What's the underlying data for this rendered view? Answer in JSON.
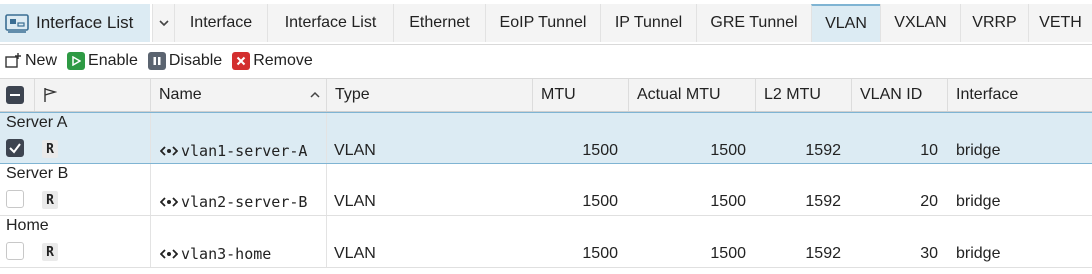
{
  "window": {
    "title": "Interface List"
  },
  "tabs": [
    {
      "label": "Interface",
      "active": false
    },
    {
      "label": "Interface List",
      "active": false
    },
    {
      "label": "Ethernet",
      "active": false
    },
    {
      "label": "EoIP Tunnel",
      "active": false
    },
    {
      "label": "IP Tunnel",
      "active": false
    },
    {
      "label": "GRE Tunnel",
      "active": false
    },
    {
      "label": "VLAN",
      "active": true
    },
    {
      "label": "VXLAN",
      "active": false
    },
    {
      "label": "VRRP",
      "active": false
    },
    {
      "label": "VETH",
      "active": false
    }
  ],
  "toolbar": {
    "new_label": "New",
    "enable_label": "Enable",
    "disable_label": "Disable",
    "remove_label": "Remove"
  },
  "table": {
    "columns": [
      "Name",
      "Type",
      "MTU",
      "Actual MTU",
      "L2 MTU",
      "VLAN ID",
      "Interface"
    ],
    "sorted_column": "Name",
    "sort_direction": "ascending",
    "groups": [
      {
        "title": "Server A",
        "selected": true,
        "row": {
          "flag": "R",
          "name": "vlan1-server-A",
          "type": "VLAN",
          "mtu": "1500",
          "actual_mtu": "1500",
          "l2_mtu": "1592",
          "vlan_id": "10",
          "interface": "bridge"
        }
      },
      {
        "title": "Server B",
        "selected": false,
        "row": {
          "flag": "R",
          "name": "vlan2-server-B",
          "type": "VLAN",
          "mtu": "1500",
          "actual_mtu": "1500",
          "l2_mtu": "1592",
          "vlan_id": "20",
          "interface": "bridge"
        }
      },
      {
        "title": "Home",
        "selected": false,
        "row": {
          "flag": "R",
          "name": "vlan3-home",
          "type": "VLAN",
          "mtu": "1500",
          "actual_mtu": "1500",
          "l2_mtu": "1592",
          "vlan_id": "30",
          "interface": "bridge"
        }
      }
    ]
  },
  "colors": {
    "selection": "#dcebf3",
    "enable_green": "#2e9a44",
    "disable_gray": "#5b6470",
    "remove_red": "#d32f2f"
  }
}
